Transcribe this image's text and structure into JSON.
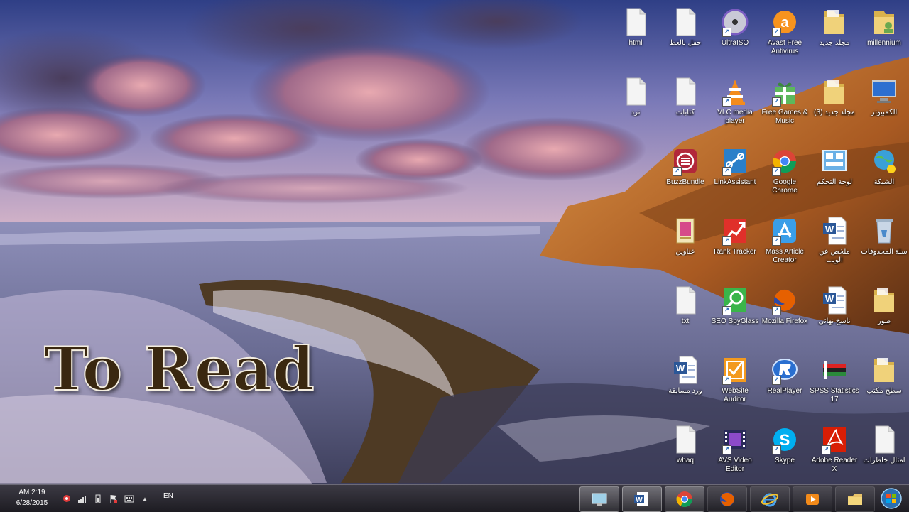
{
  "overlay": {
    "title": "To Read"
  },
  "desktop_icons": [
    {
      "id": "millennium",
      "label": "millennium",
      "kind": "folder-user"
    },
    {
      "id": "mhmd-jdyd",
      "label": "مجلد جديد",
      "kind": "folder"
    },
    {
      "id": "avast",
      "label": "Avast Free Antivirus",
      "kind": "avast"
    },
    {
      "id": "ultraiso",
      "label": "UltraISO",
      "kind": "disc"
    },
    {
      "id": "doc-arabic-1",
      "label": "حفل بالعظ",
      "kind": "blank"
    },
    {
      "id": "html",
      "label": "html",
      "kind": "blank"
    },
    {
      "id": "computer",
      "label": "الكمبيوتر",
      "kind": "computer"
    },
    {
      "id": "mhmd-jdyd-3",
      "label": "مجلد جديد (3)",
      "kind": "folder"
    },
    {
      "id": "free-games",
      "label": "Free Games & Music",
      "kind": "gift"
    },
    {
      "id": "vlc",
      "label": "VLC media player",
      "kind": "vlc"
    },
    {
      "id": "doc-arabic-2",
      "label": "كتابات",
      "kind": "blank"
    },
    {
      "id": "doc-arabic-3",
      "label": "ترد",
      "kind": "blank"
    },
    {
      "id": "network",
      "label": "الشبكة",
      "kind": "network"
    },
    {
      "id": "control",
      "label": "لوحة التحكم",
      "kind": "control"
    },
    {
      "id": "chrome",
      "label": "Google Chrome",
      "kind": "chrome"
    },
    {
      "id": "linkassistant",
      "label": "LinkAssistant",
      "kind": "linkassist"
    },
    {
      "id": "buzzbundle",
      "label": "BuzzBundle",
      "kind": "buzz"
    },
    {
      "id": "recycle",
      "label": "سلة المحذوفات",
      "kind": "recycle"
    },
    {
      "id": "word-doc-1",
      "label": "ملخص عن الويب",
      "kind": "word-doc"
    },
    {
      "id": "mass-article",
      "label": "Mass Article Creator",
      "kind": "appstore"
    },
    {
      "id": "rank-tracker",
      "label": "Rank Tracker",
      "kind": "rank"
    },
    {
      "id": "doc-arabic-4",
      "label": "عناوين",
      "kind": "book"
    },
    {
      "id": "folder-ring",
      "label": "صور",
      "kind": "folder"
    },
    {
      "id": "word-doc-2",
      "label": "ناسخ نهائي",
      "kind": "word-doc"
    },
    {
      "id": "firefox",
      "label": "Mozilla Firefox",
      "kind": "firefox"
    },
    {
      "id": "seo-spyglass",
      "label": "SEO SpyGlass",
      "kind": "spyglass"
    },
    {
      "id": "txt",
      "label": "txt",
      "kind": "blank"
    },
    {
      "id": "folder-snapshot",
      "label": "سطح مكتب",
      "kind": "folder"
    },
    {
      "id": "spss",
      "label": "SPSS Statistics 17",
      "kind": "spss"
    },
    {
      "id": "realplayer",
      "label": "RealPlayer",
      "kind": "realplayer"
    },
    {
      "id": "website-auditor",
      "label": "WebSite Auditor",
      "kind": "auditor"
    },
    {
      "id": "word-doc-3",
      "label": "ورد مسابقة",
      "kind": "word-doc"
    },
    {
      "id": "blank-last",
      "label": "أمثال خاطرات",
      "kind": "blank"
    },
    {
      "id": "adobe-reader",
      "label": "Adobe Reader X",
      "kind": "pdf"
    },
    {
      "id": "skype",
      "label": "Skype",
      "kind": "skype"
    },
    {
      "id": "avs-video",
      "label": "AVS Video Editor",
      "kind": "film"
    },
    {
      "id": "whatsapp",
      "label": "whaq",
      "kind": "blank"
    }
  ],
  "taskbar": {
    "time": "AM 2:19",
    "date": "6/28/2015",
    "language": "EN",
    "tray_icons": [
      "network-icon",
      "volume-icon",
      "battery-icon",
      "flag-icon",
      "keyboard-icon",
      "show-hidden-icon"
    ],
    "pinned": [
      {
        "id": "explorer",
        "icon": "folder-icon",
        "active": false
      },
      {
        "id": "media",
        "icon": "media-player-icon",
        "active": false
      },
      {
        "id": "ie",
        "icon": "internet-explorer-icon",
        "active": false
      },
      {
        "id": "firefox",
        "icon": "firefox-icon",
        "active": false
      },
      {
        "id": "chrome",
        "icon": "chrome-icon",
        "active": true
      },
      {
        "id": "word",
        "icon": "word-icon",
        "active": true
      },
      {
        "id": "desktop",
        "icon": "desktop-icon",
        "active": true
      }
    ],
    "start": "start-orb-icon"
  },
  "colors": {
    "sky_top": "#3a4f9c",
    "sky_mid": "#8d7fb8",
    "cloud": "#d49aa8",
    "sea": "#8a8fb0",
    "cliff": "#c27a3a",
    "taskbar": "#2a2930"
  }
}
